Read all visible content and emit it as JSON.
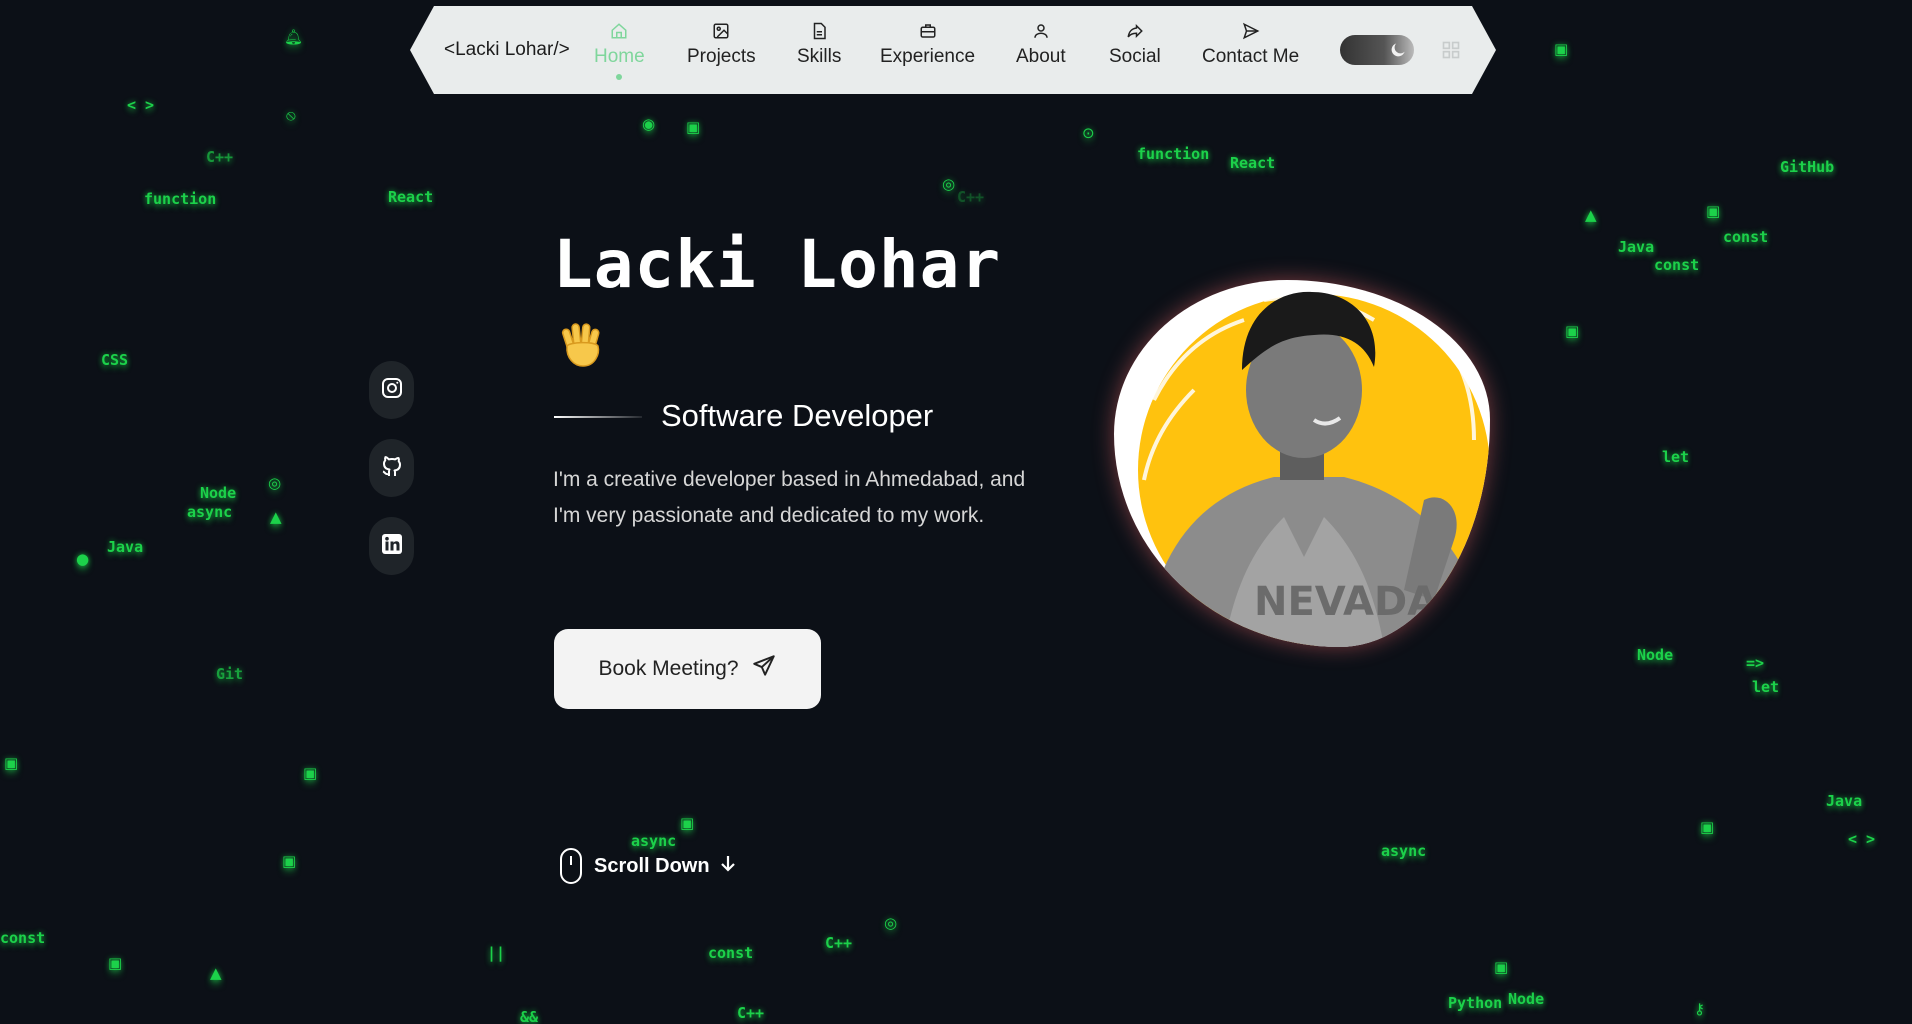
{
  "nav": {
    "brand": "<Lacki Lohar/>",
    "items": [
      {
        "label": "Home",
        "icon": "home-icon",
        "active": true
      },
      {
        "label": "Projects",
        "icon": "image-icon"
      },
      {
        "label": "Skills",
        "icon": "file-icon"
      },
      {
        "label": "Experience",
        "icon": "briefcase-icon"
      },
      {
        "label": "About",
        "icon": "user-icon"
      },
      {
        "label": "Social",
        "icon": "share-icon"
      },
      {
        "label": "Contact Me",
        "icon": "send-icon"
      }
    ],
    "theme_toggle": {
      "mode": "dark",
      "icon": "moon-icon"
    },
    "grid_icon": "grid-icon"
  },
  "hero": {
    "name": "Lacki Lohar",
    "wave_icon": "waving-hand-icon",
    "role": "Software Developer",
    "bio": "I'm a creative developer based in Ahmedabad, and I'm very passionate and dedicated to my work.",
    "cta": "Book Meeting?",
    "scroll": "Scroll Down"
  },
  "social": [
    {
      "name": "instagram",
      "icon": "instagram-icon"
    },
    {
      "name": "github",
      "icon": "github-icon"
    },
    {
      "name": "linkedin",
      "icon": "linkedin-icon"
    }
  ],
  "background_words": [
    "< >",
    "C++",
    "function",
    "React",
    "CSS",
    "Node",
    "async",
    "Java",
    "Git",
    "const",
    "||",
    "function",
    "React",
    "C++",
    "GitHub",
    "const",
    "Java",
    "const",
    "let",
    "Node",
    "=>",
    "let",
    "Java",
    "< >",
    "async",
    "Python",
    "Node",
    "async",
    "const",
    "C++",
    "&&",
    "C++"
  ],
  "colors": {
    "background": "#0c1017",
    "accent_green": "#1cd14a",
    "nav_bg": "#e9ecec",
    "nav_active": "#7fd69c",
    "avatar_yellow": "#ffc20e"
  }
}
